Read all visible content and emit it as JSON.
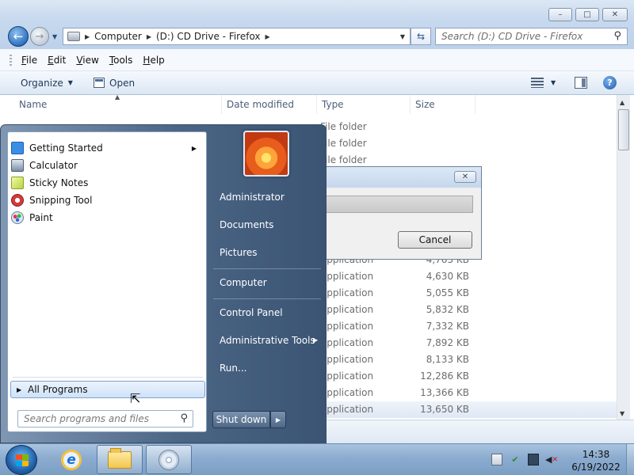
{
  "explorer": {
    "window_buttons": [
      "–",
      "□",
      "✕"
    ],
    "address": {
      "crumbs": [
        "Computer",
        "(D:) CD Drive - Firefox"
      ]
    },
    "search_placeholder": "Search (D:) CD Drive - Firefox",
    "menubar": [
      {
        "ul": "F",
        "rest": "ile"
      },
      {
        "ul": "E",
        "rest": "dit"
      },
      {
        "ul": "V",
        "rest": "iew"
      },
      {
        "ul": "T",
        "rest": "ools"
      },
      {
        "ul": "H",
        "rest": "elp"
      }
    ],
    "commandbar": {
      "organize": "Organize",
      "open": "Open",
      "help": "?"
    },
    "columns": {
      "name": "Name",
      "date": "Date modified",
      "type": "Type",
      "size": "Size"
    },
    "rows": [
      {
        "type": "File folder",
        "size": ""
      },
      {
        "type": "File folder",
        "size": ""
      },
      {
        "type": "File folder",
        "size": ""
      },
      {
        "type": "",
        "size": ""
      },
      {
        "type": "",
        "size": ""
      },
      {
        "type": "",
        "size": ""
      },
      {
        "type": "",
        "size": ""
      },
      {
        "type": "",
        "size": ""
      },
      {
        "type": "Application",
        "size": "4,765 KB"
      },
      {
        "type": "Application",
        "size": "4,630 KB"
      },
      {
        "type": "Application",
        "size": "5,055 KB"
      },
      {
        "type": "Application",
        "size": "5,832 KB"
      },
      {
        "type": "Application",
        "size": "7,332 KB"
      },
      {
        "type": "Application",
        "size": "7,892 KB"
      },
      {
        "type": "Application",
        "size": "8,133 KB"
      },
      {
        "type": "Application",
        "size": "12,286 KB"
      },
      {
        "type": "Application",
        "size": "13,366 KB"
      },
      {
        "type": "Application",
        "size": "13,650 KB"
      }
    ]
  },
  "dialog": {
    "close": "✕",
    "cancel": "Cancel"
  },
  "start_menu": {
    "programs": [
      {
        "label": "Getting Started",
        "icon": "getting-started-icon",
        "color": "#3a8ee6",
        "has_submenu": true
      },
      {
        "label": "Calculator",
        "icon": "calculator-icon",
        "color": "#7a8ea6",
        "has_submenu": false
      },
      {
        "label": "Sticky Notes",
        "icon": "sticky-notes-icon",
        "color": "#d9e86a",
        "has_submenu": false
      },
      {
        "label": "Snipping Tool",
        "icon": "snipping-tool-icon",
        "color": "#d23b3b",
        "has_submenu": false
      },
      {
        "label": "Paint",
        "icon": "paint-icon",
        "color": "#5aa0d8",
        "has_submenu": false
      }
    ],
    "all_programs": "All Programs",
    "search_placeholder": "Search programs and files",
    "places": [
      {
        "label": "Administrator",
        "has_submenu": false
      },
      {
        "label": "Documents",
        "has_submenu": false
      },
      {
        "label": "Pictures",
        "has_submenu": false
      },
      {
        "label": "Computer",
        "has_submenu": false
      },
      {
        "label": "Control Panel",
        "has_submenu": false
      },
      {
        "label": "Administrative Tools",
        "has_submenu": true
      },
      {
        "label": "Run...",
        "has_submenu": false
      }
    ],
    "shutdown": "Shut down"
  },
  "taskbar": {
    "clock_time": "14:38",
    "clock_date": "6/19/2022",
    "accent": "#8baccf"
  }
}
